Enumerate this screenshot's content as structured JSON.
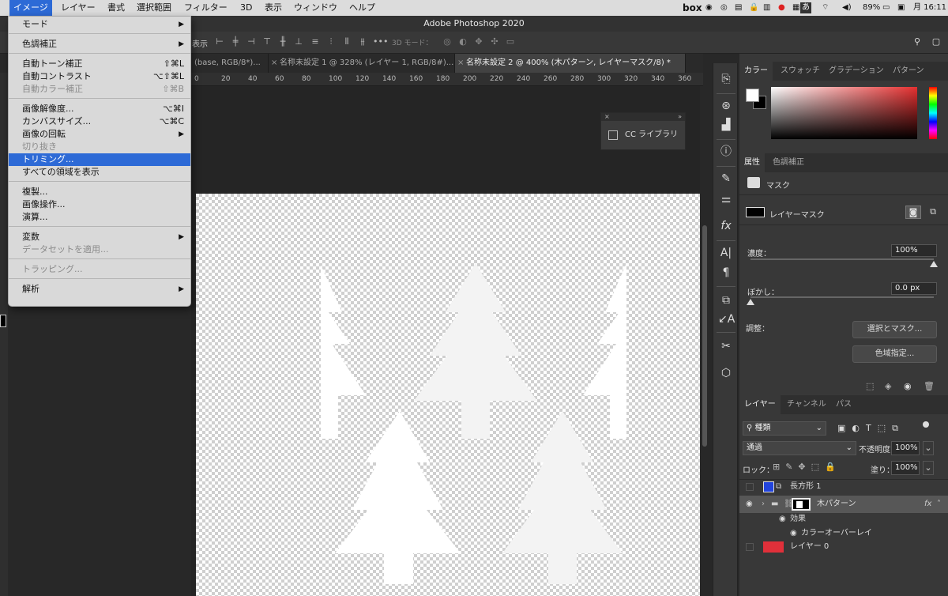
{
  "menubar": {
    "items": [
      "イメージ",
      "レイヤー",
      "書式",
      "選択範囲",
      "フィルター",
      "3D",
      "表示",
      "ウィンドウ",
      "ヘルプ"
    ],
    "active_index": 0,
    "right": {
      "box": "box",
      "battery": "89%",
      "clock": "月 16:11",
      "ime": "あ"
    }
  },
  "window": {
    "title": "Adobe Photoshop 2020"
  },
  "options": {
    "mode3d": "3D モード：",
    "bleed": "表示"
  },
  "tabs": [
    {
      "label": "(base, RGB/8*)...",
      "active": false
    },
    {
      "label": "名称未設定 1 @ 328% (レイヤー 1, RGB/8#)...",
      "active": false
    },
    {
      "label": "名称未設定 2 @ 400% (木パターン, レイヤーマスク/8) *",
      "active": true
    }
  ],
  "ruler": [
    "0",
    "20",
    "40",
    "60",
    "80",
    "100",
    "120",
    "140",
    "160",
    "180",
    "200",
    "220",
    "240",
    "260",
    "280",
    "300",
    "320",
    "340",
    "360"
  ],
  "cc_library": {
    "title": "CC ライブラリ"
  },
  "image_menu": {
    "groups": [
      [
        {
          "label": "モード",
          "submenu": true,
          "disabled": false,
          "shortcut": ""
        }
      ],
      [
        {
          "label": "色調補正",
          "submenu": true,
          "disabled": false,
          "shortcut": ""
        }
      ],
      [
        {
          "label": "自動トーン補正",
          "submenu": false,
          "disabled": false,
          "shortcut": "⇧⌘L"
        },
        {
          "label": "自動コントラスト",
          "submenu": false,
          "disabled": false,
          "shortcut": "⌥⇧⌘L"
        },
        {
          "label": "自動カラー補正",
          "submenu": false,
          "disabled": true,
          "shortcut": "⇧⌘B"
        }
      ],
      [
        {
          "label": "画像解像度...",
          "submenu": false,
          "disabled": false,
          "shortcut": "⌥⌘I"
        },
        {
          "label": "カンバスサイズ...",
          "submenu": false,
          "disabled": false,
          "shortcut": "⌥⌘C"
        },
        {
          "label": "画像の回転",
          "submenu": true,
          "disabled": false,
          "shortcut": ""
        },
        {
          "label": "切り抜き",
          "submenu": false,
          "disabled": true,
          "shortcut": ""
        },
        {
          "label": "トリミング...",
          "submenu": false,
          "disabled": false,
          "shortcut": "",
          "highlighted": true
        },
        {
          "label": "すべての領域を表示",
          "submenu": false,
          "disabled": false,
          "shortcut": ""
        }
      ],
      [
        {
          "label": "複製...",
          "submenu": false,
          "disabled": false,
          "shortcut": ""
        },
        {
          "label": "画像操作...",
          "submenu": false,
          "disabled": false,
          "shortcut": ""
        },
        {
          "label": "演算...",
          "submenu": false,
          "disabled": false,
          "shortcut": ""
        }
      ],
      [
        {
          "label": "変数",
          "submenu": true,
          "disabled": false,
          "shortcut": ""
        },
        {
          "label": "データセットを適用...",
          "submenu": false,
          "disabled": true,
          "shortcut": ""
        }
      ],
      [
        {
          "label": "トラッピング...",
          "submenu": false,
          "disabled": true,
          "shortcut": ""
        }
      ],
      [
        {
          "label": "解析",
          "submenu": true,
          "disabled": false,
          "shortcut": ""
        }
      ]
    ]
  },
  "color_panel": {
    "tabs": [
      "カラー",
      "スウォッチ",
      "グラデーション",
      "パターン"
    ]
  },
  "properties_panel": {
    "tabs": [
      "属性",
      "色調補正"
    ],
    "mask_label": "マスク",
    "layer_mask_label": "レイヤーマスク",
    "density_label": "濃度：",
    "density_value": "100%",
    "density_level": 1.0,
    "feather_label": "ぼかし：",
    "feather_value": "0.0 px",
    "feather_level": 0.0,
    "adjust_label": "調整：",
    "select_mask_button": "選択とマスク...",
    "color_range_button": "色域指定..."
  },
  "layers_panel": {
    "tabs": [
      "レイヤー",
      "チャンネル",
      "パス"
    ],
    "filter_kind": "種類",
    "blend_mode": "通過",
    "opacity_label": "不透明度：",
    "opacity_value": "100%",
    "lock_label": "ロック：",
    "fill_label": "塗り：",
    "fill_value": "100%",
    "layers": [
      {
        "name": "長方形 1",
        "visible": false
      },
      {
        "name": "木パターン",
        "visible": true
      },
      {
        "name": "効果",
        "visible": true
      },
      {
        "name": "カラーオーバーレイ",
        "visible": true
      },
      {
        "name": "レイヤー 0",
        "visible": false
      }
    ]
  }
}
